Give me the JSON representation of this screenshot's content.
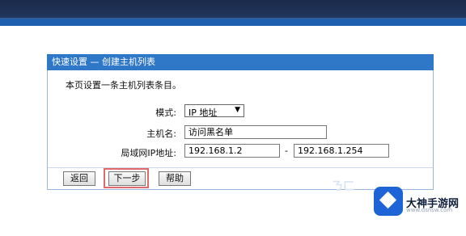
{
  "panel": {
    "header": "快速设置 — 创建主机列表",
    "description": "本页设置一条主机列表条目。"
  },
  "form": {
    "mode_label": "模式:",
    "mode_value": "IP 地址",
    "host_label": "主机名:",
    "host_value": "访问黑名单",
    "ip_label": "局域网IP地址:",
    "ip_start": "192.168.1.2",
    "ip_separator": "-",
    "ip_end": "192.168.1.254"
  },
  "buttons": {
    "back": "返回",
    "next": "下一步",
    "help": "帮助"
  },
  "watermark": {
    "title": "大神手游网",
    "url": "www.dsnsw.com",
    "faint": "ㄋㄈ"
  },
  "icons": {
    "dropdown": "chevron-down-icon",
    "logo": "cube-logo-icon"
  },
  "colors": {
    "header_bg": "#2f78c8",
    "highlight": "#e06a6a",
    "brand": "#1e64d6"
  }
}
